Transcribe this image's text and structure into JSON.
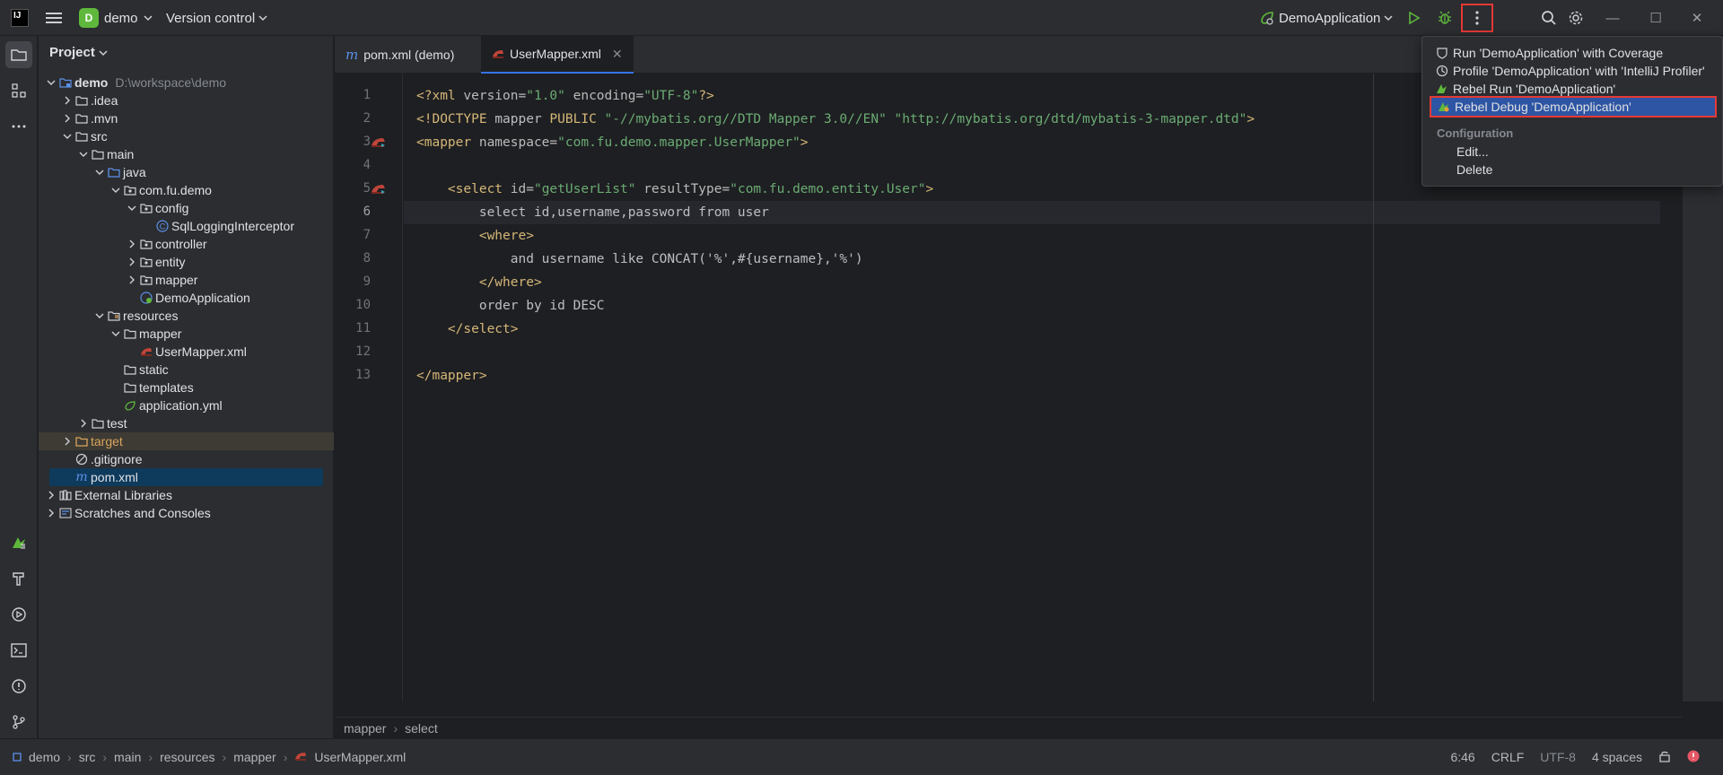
{
  "titlebar": {
    "logo_text": "IJ",
    "project_badge": "D",
    "project_name": "demo",
    "vcs_label": "Version control",
    "run_config": "DemoApplication"
  },
  "project_panel": {
    "title": "Project",
    "tree": [
      {
        "label": "demo",
        "path": "D:\\workspace\\demo",
        "depth": 0,
        "open": true,
        "icon": "module-icon",
        "bold": true
      },
      {
        "label": ".idea",
        "depth": 1,
        "open": false,
        "icon": "folder-icon"
      },
      {
        "label": ".mvn",
        "depth": 1,
        "open": false,
        "icon": "folder-icon"
      },
      {
        "label": "src",
        "depth": 1,
        "open": true,
        "icon": "folder-icon"
      },
      {
        "label": "main",
        "depth": 2,
        "open": true,
        "icon": "folder-icon"
      },
      {
        "label": "java",
        "depth": 3,
        "open": true,
        "icon": "source-folder-icon"
      },
      {
        "label": "com.fu.demo",
        "depth": 4,
        "open": true,
        "icon": "package-icon"
      },
      {
        "label": "config",
        "depth": 5,
        "open": true,
        "icon": "package-icon"
      },
      {
        "label": "SqlLoggingInterceptor",
        "depth": 6,
        "icon": "class-icon"
      },
      {
        "label": "controller",
        "depth": 5,
        "open": false,
        "icon": "package-icon"
      },
      {
        "label": "entity",
        "depth": 5,
        "open": false,
        "icon": "package-icon"
      },
      {
        "label": "mapper",
        "depth": 5,
        "open": false,
        "icon": "package-icon"
      },
      {
        "label": "DemoApplication",
        "depth": 5,
        "icon": "spring-class-icon"
      },
      {
        "label": "resources",
        "depth": 3,
        "open": true,
        "icon": "resources-folder-icon"
      },
      {
        "label": "mapper",
        "depth": 4,
        "open": true,
        "icon": "folder-icon"
      },
      {
        "label": "UserMapper.xml",
        "depth": 5,
        "icon": "mybatis-xml-icon"
      },
      {
        "label": "static",
        "depth": 4,
        "icon": "folder-icon"
      },
      {
        "label": "templates",
        "depth": 4,
        "icon": "folder-icon"
      },
      {
        "label": "application.yml",
        "depth": 4,
        "icon": "yml-icon"
      },
      {
        "label": "test",
        "depth": 2,
        "open": false,
        "icon": "folder-icon"
      },
      {
        "label": "target",
        "depth": 1,
        "open": false,
        "icon": "excluded-folder-icon",
        "highlight": "target"
      },
      {
        "label": ".gitignore",
        "depth": 1,
        "icon": "gitignore-icon"
      },
      {
        "label": "pom.xml",
        "depth": 1,
        "icon": "maven-icon",
        "highlight": "selected"
      },
      {
        "label": "External Libraries",
        "depth": 0,
        "open": false,
        "icon": "libraries-icon"
      },
      {
        "label": "Scratches and Consoles",
        "depth": 0,
        "open": false,
        "icon": "scratches-icon"
      }
    ]
  },
  "editor": {
    "tabs": [
      {
        "label": "pom.xml (demo)",
        "icon": "m"
      },
      {
        "label": "UserMapper.xml",
        "icon": "mybatis"
      }
    ],
    "current_line": 6,
    "lines": [
      [
        {
          "t": "tag",
          "v": "<?xml "
        },
        {
          "t": "attr",
          "v": "version="
        },
        {
          "t": "str",
          "v": "\"1.0\""
        },
        {
          "t": "attr",
          "v": " encoding="
        },
        {
          "t": "str",
          "v": "\"UTF-8\""
        },
        {
          "t": "tag",
          "v": "?>"
        }
      ],
      [
        {
          "t": "tag",
          "v": "<!DOCTYPE "
        },
        {
          "t": "txt",
          "v": "mapper "
        },
        {
          "t": "tag",
          "v": "PUBLIC "
        },
        {
          "t": "str",
          "v": "\"-//mybatis.org//DTD Mapper 3.0//EN\" \"http://mybatis.org/dtd/mybatis-3-mapper.dtd\""
        },
        {
          "t": "tag",
          "v": ">"
        }
      ],
      [
        {
          "t": "tag",
          "v": "<mapper "
        },
        {
          "t": "attr",
          "v": "namespace="
        },
        {
          "t": "str",
          "v": "\"com.fu.demo.mapper.UserMapper\""
        },
        {
          "t": "tag",
          "v": ">"
        }
      ],
      [],
      [
        {
          "t": "txt",
          "v": "    "
        },
        {
          "t": "tag",
          "v": "<select "
        },
        {
          "t": "attr",
          "v": "id="
        },
        {
          "t": "str",
          "v": "\"getUserList\""
        },
        {
          "t": "attr",
          "v": " resultType="
        },
        {
          "t": "str",
          "v": "\"com.fu.demo.entity.User\""
        },
        {
          "t": "tag",
          "v": ">"
        }
      ],
      [
        {
          "t": "txt",
          "v": "        select id,username,password from user"
        }
      ],
      [
        {
          "t": "txt",
          "v": "        "
        },
        {
          "t": "tag",
          "v": "<where>"
        }
      ],
      [
        {
          "t": "txt",
          "v": "            and username like CONCAT('%',#{username},'%')"
        }
      ],
      [
        {
          "t": "txt",
          "v": "        "
        },
        {
          "t": "tag",
          "v": "</where>"
        }
      ],
      [
        {
          "t": "txt",
          "v": "        order by id DESC"
        }
      ],
      [
        {
          "t": "txt",
          "v": "    "
        },
        {
          "t": "tag",
          "v": "</select>"
        }
      ],
      [],
      [
        {
          "t": "tag",
          "v": "</mapper>"
        }
      ]
    ],
    "gutter_marks": [
      3,
      5
    ],
    "breadcrumb": [
      "mapper",
      "select"
    ]
  },
  "popup": {
    "items": [
      {
        "label": "Run 'DemoApplication' with Coverage",
        "icon": "coverage-icon"
      },
      {
        "label": "Profile 'DemoApplication' with 'IntelliJ Profiler'",
        "icon": "profiler-icon"
      },
      {
        "label": "Rebel Run 'DemoApplication'",
        "icon": "jrebel-run-icon"
      },
      {
        "label": "Rebel Debug 'DemoApplication'",
        "icon": "jrebel-debug-icon",
        "highlighted": true
      }
    ],
    "section": "Configuration",
    "sub_items": [
      "Edit...",
      "Delete"
    ]
  },
  "statusbar": {
    "crumbs": [
      "demo",
      "src",
      "main",
      "resources",
      "mapper",
      "UserMapper.xml"
    ],
    "position": "6:46",
    "line_sep": "CRLF",
    "encoding": "UTF-8",
    "indent": "4 spaces"
  },
  "colors": {
    "accent": "#3574f0",
    "highlight_border": "#e53935",
    "run_green": "#5fb83c"
  }
}
